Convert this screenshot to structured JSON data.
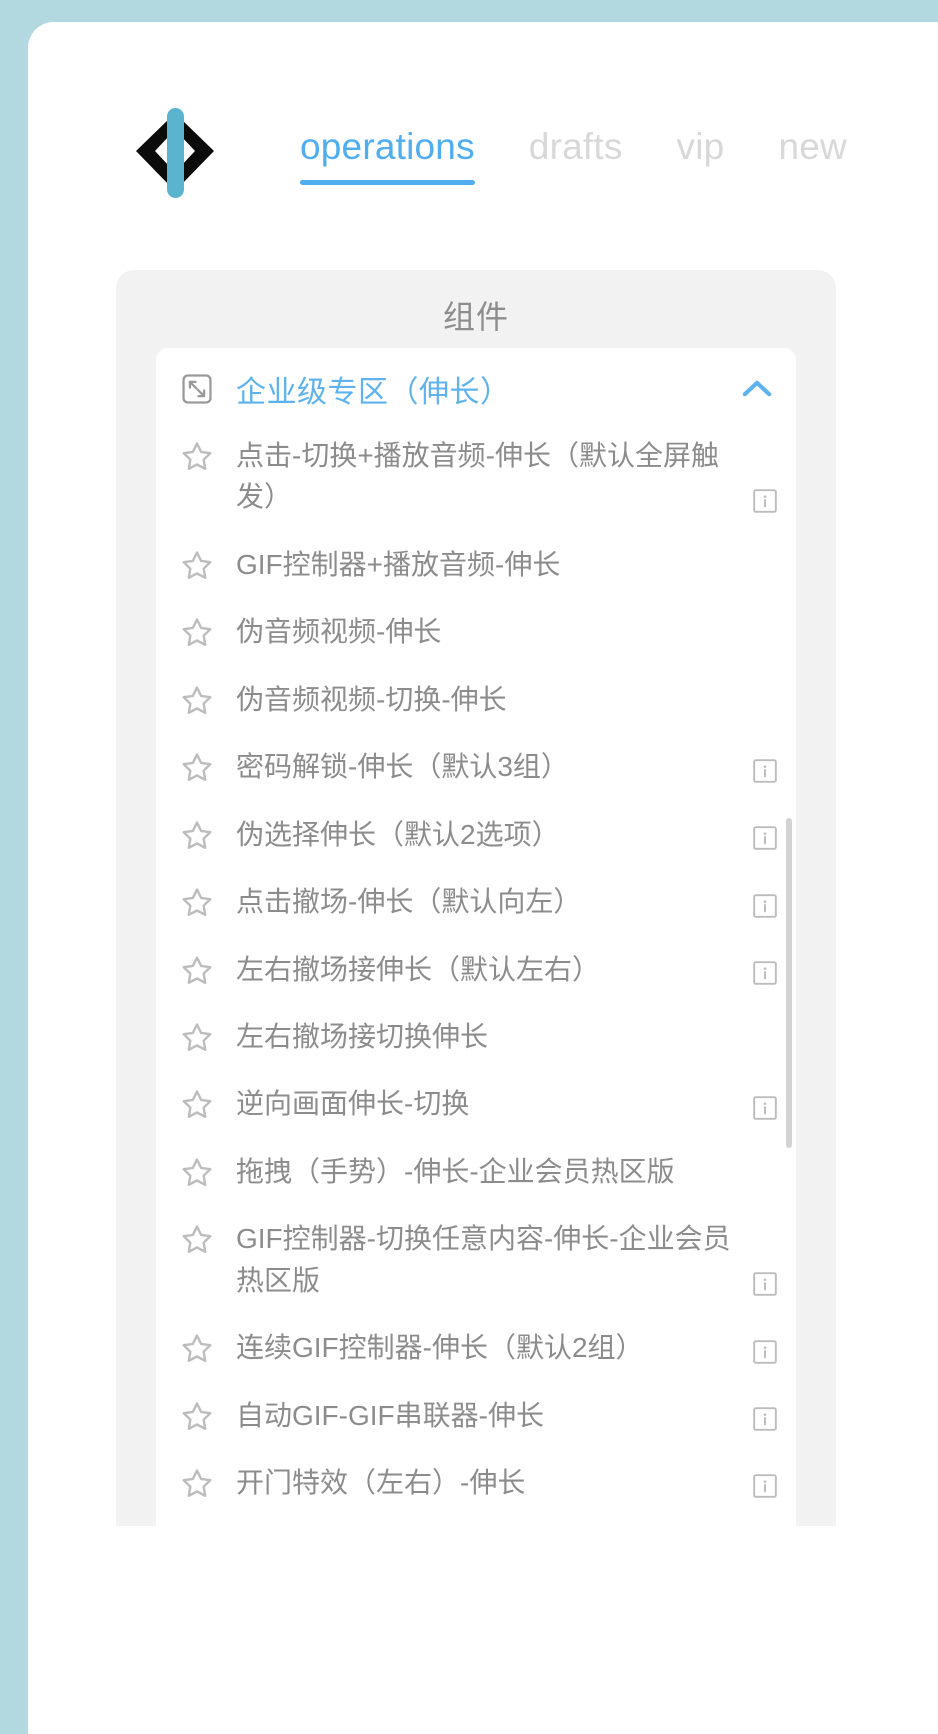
{
  "header": {
    "logo_icon": "code-brackets-logo",
    "tabs": [
      {
        "label": "operations",
        "active": true
      },
      {
        "label": "drafts",
        "active": false
      },
      {
        "label": "vip",
        "active": false
      },
      {
        "label": "new",
        "active": false
      }
    ]
  },
  "panel": {
    "title": "组件",
    "section": {
      "expand_icon": "fullscreen-expand-icon",
      "label": "企业级专区（伸长）",
      "collapse_icon": "chevron-up-icon",
      "expanded": true
    },
    "items": [
      {
        "label": "点击-切换+播放音频-伸长（默认全屏触发）",
        "star_icon": "star-outline-icon",
        "info": true
      },
      {
        "label": "GIF控制器+播放音频-伸长",
        "star_icon": "star-outline-icon",
        "info": false
      },
      {
        "label": "伪音频视频-伸长",
        "star_icon": "star-outline-icon",
        "info": false
      },
      {
        "label": "伪音频视频-切换-伸长",
        "star_icon": "star-outline-icon",
        "info": false
      },
      {
        "label": "密码解锁-伸长（默认3组）",
        "star_icon": "star-outline-icon",
        "info": true
      },
      {
        "label": "伪选择伸长（默认2选项）",
        "star_icon": "star-outline-icon",
        "info": true
      },
      {
        "label": "点击撤场-伸长（默认向左）",
        "star_icon": "star-outline-icon",
        "info": true
      },
      {
        "label": "左右撤场接伸长（默认左右）",
        "star_icon": "star-outline-icon",
        "info": true
      },
      {
        "label": "左右撤场接切换伸长",
        "star_icon": "star-outline-icon",
        "info": false
      },
      {
        "label": "逆向画面伸长-切换",
        "star_icon": "star-outline-icon",
        "info": true
      },
      {
        "label": "拖拽（手势）-伸长-企业会员热区版",
        "star_icon": "star-outline-icon",
        "info": false
      },
      {
        "label": "GIF控制器-切换任意内容-伸长-企业会员热区版",
        "star_icon": "star-outline-icon",
        "info": true
      },
      {
        "label": "连续GIF控制器-伸长（默认2组）",
        "star_icon": "star-outline-icon",
        "info": true
      },
      {
        "label": "自动GIF-GIF串联器-伸长",
        "star_icon": "star-outline-icon",
        "info": true
      },
      {
        "label": "开门特效（左右）-伸长",
        "star_icon": "star-outline-icon",
        "info": true
      }
    ]
  },
  "colors": {
    "accent": "#4fadf0",
    "section_label": "#5eb3ef",
    "text_muted": "#8c8c8c",
    "tab_inactive": "#d8d8d8",
    "panel_bg": "#f2f2f2",
    "page_bg": "#b3d9e0",
    "logo_cyan": "#5bb4cd",
    "logo_black": "#0b0b0b"
  }
}
